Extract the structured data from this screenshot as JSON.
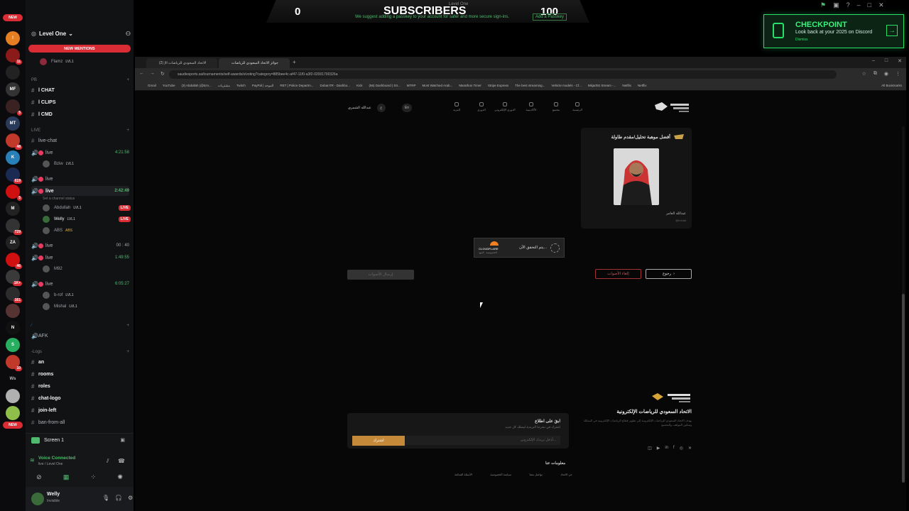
{
  "stream": {
    "title": "Level One",
    "subs_current": "0",
    "subs_label": "SUBSCRIBERS",
    "subs_goal": "100",
    "passkey_notice": "We suggest adding a passkey to your account for safer and more secure sign-ins.",
    "passkey_button": "Add a Passkey"
  },
  "checkpoint": {
    "title": "CHECKPOINT",
    "subtitle": "Look back at your 2025 on Discord",
    "dismiss": "Dismiss"
  },
  "discord": {
    "server_new": "NEW",
    "server_new_bottom": "NEW",
    "server_badges": [
      "11",
      "5",
      "48",
      "619",
      "5",
      "729",
      "46",
      "1K+",
      "161",
      "10"
    ],
    "server_label_ws": "Ws",
    "guild_name": "Level One",
    "new_mentions": "NEW MENTIONS",
    "top_member": "Flamz",
    "top_member_tag": "LVL1",
    "categories": {
      "pb": "PB",
      "live": "LIVE",
      "logs": "Logs"
    },
    "pb_channels": [
      "l CHAT",
      "l CLIPS",
      "l CMD"
    ],
    "live_chat": "live-chat",
    "voice_channels": [
      {
        "name": "live",
        "time": "4:21:58",
        "members": [
          {
            "name": "Bziw",
            "tag": "LVL1",
            "live": ""
          }
        ]
      },
      {
        "name": "live",
        "time": "",
        "members": []
      },
      {
        "name": "live",
        "time": "2:42:49",
        "status": "Set a channel status",
        "members": [
          {
            "name": "Abdullah",
            "tag": "LVL1",
            "live": "LIVE"
          },
          {
            "name": "Welly",
            "tag": "LVL1",
            "live": "LIVE"
          },
          {
            "name": "ABS",
            "tag": "ABS",
            "live": ""
          }
        ]
      },
      {
        "name": "live",
        "time": "00 : 40",
        "members": [
          {
            "name": "M92",
            "tag": "",
            "live": ""
          }
        ]
      },
      {
        "name": "live",
        "time": "1:49:55",
        "members": []
      },
      {
        "name": "live",
        "time": "6:05:27",
        "members": [
          {
            "name": "b-rof",
            "tag": "LVL1",
            "live": ""
          },
          {
            "name": "Mishal",
            "tag": "LVL1",
            "live": ""
          }
        ]
      }
    ],
    "afk": "AFK",
    "log_channels": [
      "an",
      "rooms",
      "roles",
      "chat-logo",
      "join-left",
      "ban-from-all"
    ],
    "screen_share": "Screen 1",
    "voice_status": "Voice Connected",
    "voice_location": "live / Level One",
    "user_name": "Welly",
    "user_status": "Invisible"
  },
  "browser": {
    "tabs": [
      "(2) الاتحاد السعودي للرياضات الإ",
      "جوائز الاتحاد السعودي للرياضات"
    ],
    "url": "saudiesports.sa/tournaments/self-awards/s/voting?category=885bee4c-af47-11f0-a3f2-02001700326a",
    "bookmarks": [
      "Gmail",
      "YouTube",
      "(3) Abdullah (@tcm...",
      "مشتريات",
      "Twitch",
      "PayPal | الموحد",
      "RET | Police Departm...",
      "DobanTR - Dashbo...",
      "Kick",
      "(56) Dashboard | Str...",
      "MTRP",
      "Most Watched Arab...",
      "Marathon Timer",
      "Stripe Express",
      "The best streaming...",
      "Vehicle models - Cf...",
      "Mkjart92 Stream -...",
      "Netflix",
      "Netflix"
    ],
    "all_bookmarks": "All Bookmarks"
  },
  "site": {
    "nav": [
      "الرئيسية",
      "مجتمع",
      "الأكاديمية",
      "الدوري الإلكتروني",
      "الدوري",
      "المزيد"
    ],
    "lang": "En",
    "user_name": "عبدالله الشمري",
    "nominee_category": "أفضل موهبة تحليل/مقدم طاولة",
    "nominee_name": "عبدالله العامر",
    "nominee_handle": "@imotal",
    "cloudflare_text": "يتم التحقق الآن...",
    "cloudflare_brand": "CLOUDFLARE",
    "cloudflare_privacy": "الخصوصية - البنود",
    "submit_votes": "إرسال الأصوات",
    "cancel_votes": "إلغاء الأصوات",
    "back": "رجوع",
    "footer_title": "الاتحاد السعودي للرياضات الإلكترونية",
    "footer_desc": "يهدف الاتحاد السعودي للرياضات الإلكترونية إلى تطوير قطاع الرياضات الإلكترونية في المملكة وتمكين المواهب والمجتمع",
    "newsletter_title": "ابقَ على اطلاع",
    "newsletter_sub": "اشترك في نشرتنا البريدية ليصلك كل جديد",
    "newsletter_placeholder": "أدخل بريدك الإلكتروني...",
    "newsletter_button": "اشترك",
    "about_title": "معلومات عنا",
    "footer_links": [
      "عن الاتحاد",
      "تواصل معنا",
      "سياسة الخصوصية",
      "الأسئلة الشائعة"
    ]
  }
}
